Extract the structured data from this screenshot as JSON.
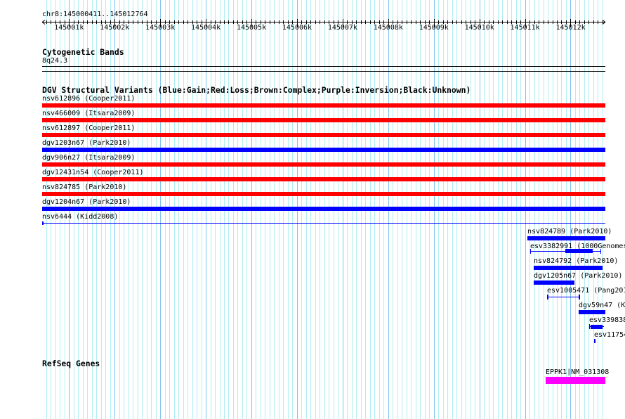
{
  "ruler": {
    "region": "chr8:145000411..145012764",
    "ticks": [
      "145001k",
      "145002k",
      "145003k",
      "145004k",
      "145005k",
      "145006k",
      "145007k",
      "145008k",
      "145009k",
      "145010k",
      "145011k",
      "145012k"
    ]
  },
  "cytoband": {
    "title": "Cytogenetic Bands",
    "band": "8q24.3"
  },
  "dgv": {
    "title": "DGV Structural Variants (Blue:Gain;Red:Loss;Brown:Complex;Purple:Inversion;Black:Unknown)",
    "colors": {
      "gain": "#0000ff",
      "loss": "#ff0000"
    },
    "features": [
      {
        "label": "nsv612896 (Cooper2011)",
        "type": "loss"
      },
      {
        "label": "nsv466009 (Itsara2009)",
        "type": "loss"
      },
      {
        "label": "nsv612897 (Cooper2011)",
        "type": "loss"
      },
      {
        "label": "dgv1203n67 (Park2010)",
        "type": "gain"
      },
      {
        "label": "dgv906n27 (Itsara2009)",
        "type": "loss"
      },
      {
        "label": "dgv12431n54 (Cooper2011)",
        "type": "loss"
      },
      {
        "label": "nsv824785 (Park2010)",
        "type": "loss"
      },
      {
        "label": "dgv1204n67 (Park2010)",
        "type": "gain"
      },
      {
        "label": "nsv6444 (Kidd2008)",
        "type": "gain"
      }
    ],
    "right_features": [
      {
        "label": "nsv824789 (Park2010)"
      },
      {
        "label": "esv3382991 (1000Genomes"
      },
      {
        "label": "nsv824792 (Park2010)"
      },
      {
        "label": "dgv1205n67 (Park2010)"
      },
      {
        "label": "esv1005471 (Pang201"
      },
      {
        "label": "dgv59n47 (K"
      },
      {
        "label": "esv339838"
      },
      {
        "label": "esv11754"
      }
    ]
  },
  "refseq": {
    "title": "RefSeq Genes",
    "gene": "EPPK1|NM_031308",
    "color": "#ff00ff"
  }
}
